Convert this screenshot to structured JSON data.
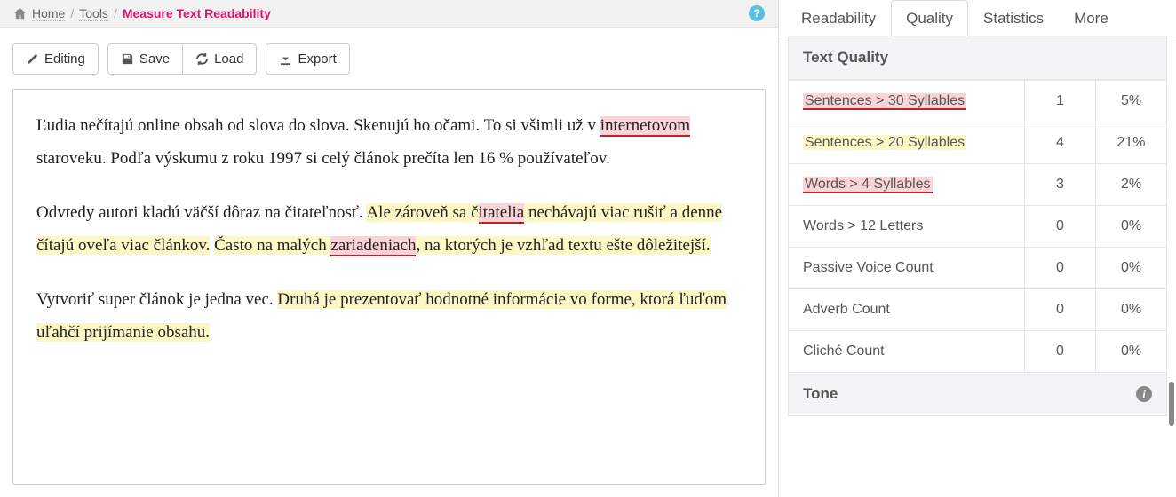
{
  "breadcrumb": {
    "home": "Home",
    "tools": "Tools",
    "current": "Measure Text Readability"
  },
  "toolbar": {
    "editing": "Editing",
    "save": "Save",
    "load": "Load",
    "export": "Export"
  },
  "editor": {
    "p1_a": "Ľudia nečítajú online obsah od slova do slova. Skenujú ho očami. To si všimli už v ",
    "p1_hl1": "internetovom",
    "p1_b": " staroveku. Podľa výskumu z roku 1997 si celý článok prečíta len 16 % používateľov.",
    "p2_a": "Odvtedy autori kladú väčší dôraz na čitateľnosť. ",
    "p2_hl_y1a": "Ale zároveň sa č",
    "p2_hl_p1": "itatelia",
    "p2_hl_y1b": " nechávajú viac rušiť a denne čítajú oveľa viac článkov.",
    "p2_b": " ",
    "p2_hl_y2a": "Často na malých ",
    "p2_hl_p2": "zariadeniach",
    "p2_hl_y2b": ", na ktorých je vzhľad textu ešte dôležitejší.",
    "p3_a": "Vytvoriť super článok je jedna vec. ",
    "p3_hl_y": "Druhá je prezentovať hodnotné informácie vo forme, ktorá ľuďom uľahčí prijímanie obsahu."
  },
  "tabs": {
    "readability": "Readability",
    "quality": "Quality",
    "statistics": "Statistics",
    "more": "More"
  },
  "quality": {
    "header": "Text Quality",
    "tone_header": "Tone",
    "rows": [
      {
        "label": "Sentences > 30 Syllables",
        "count": "1",
        "pct": "5%",
        "style": "pink"
      },
      {
        "label": "Sentences > 20 Syllables",
        "count": "4",
        "pct": "21%",
        "style": "yellow"
      },
      {
        "label": "Words > 4 Syllables",
        "count": "3",
        "pct": "2%",
        "style": "pink"
      },
      {
        "label": "Words > 12 Letters",
        "count": "0",
        "pct": "0%",
        "style": "none"
      },
      {
        "label": "Passive Voice Count",
        "count": "0",
        "pct": "0%",
        "style": "none"
      },
      {
        "label": "Adverb Count",
        "count": "0",
        "pct": "0%",
        "style": "none"
      },
      {
        "label": "Cliché Count",
        "count": "0",
        "pct": "0%",
        "style": "none"
      }
    ]
  }
}
